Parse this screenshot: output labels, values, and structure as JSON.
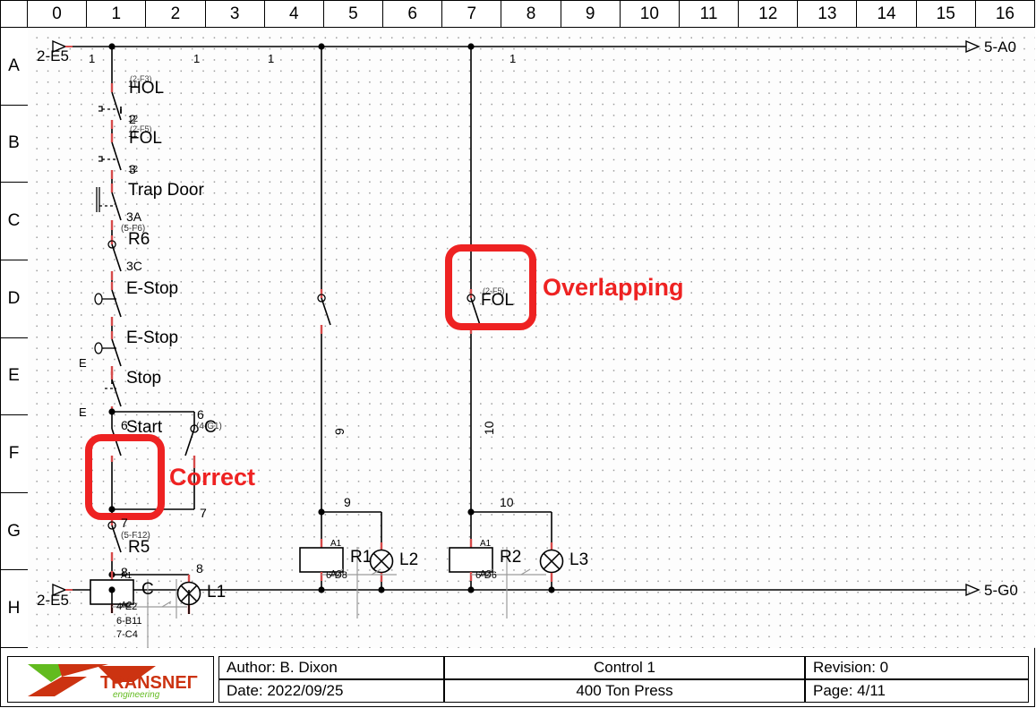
{
  "sheet": {
    "columns": [
      "0",
      "1",
      "2",
      "3",
      "4",
      "5",
      "6",
      "7",
      "8",
      "9",
      "10",
      "11",
      "12",
      "13",
      "14",
      "15",
      "16"
    ],
    "rows": [
      "A",
      "B",
      "C",
      "D",
      "E",
      "F",
      "G",
      "H"
    ]
  },
  "annotations": [
    {
      "id": "correct",
      "label": "Correct",
      "color": "#ee2222"
    },
    {
      "id": "overlapping",
      "label": "Overlapping",
      "color": "#ee2222"
    }
  ],
  "connectors": {
    "top_left": "2-E5",
    "top_right": "5-A0",
    "bottom_left": "2-E5",
    "bottom_right": "5-G0"
  },
  "wire_numbers": {
    "top_rail": [
      "1",
      "1",
      "1",
      "1"
    ],
    "rung1": [
      "2",
      "3",
      "3A",
      "3C",
      "6",
      "6",
      "7",
      "7",
      "8"
    ],
    "rung2_vertical": "9",
    "rung3_vertical": "10",
    "rung2_top": "9",
    "rung3_top": "10"
  },
  "rung1": {
    "devices": [
      {
        "name": "HOL",
        "type": "nc-limit-switch",
        "terminal_top": "11",
        "terminal_bottom": "12",
        "xref": "(2-F3)"
      },
      {
        "name": "FOL",
        "type": "nc-limit-switch",
        "terminal_top": "11",
        "terminal_bottom": "12",
        "xref": "(2-F5)"
      },
      {
        "name": "Trap Door",
        "type": "nc-door-switch",
        "wire_above": "3"
      },
      {
        "name": "R6",
        "type": "nc-relay-contact",
        "wire_above": "3A",
        "xref": "(5-F6)"
      },
      {
        "name": "E-Stop",
        "type": "nc-estop",
        "wire_above": "3C"
      },
      {
        "name": "E-Stop",
        "type": "nc-estop"
      },
      {
        "name": "Stop",
        "type": "nc-pushbutton",
        "terminal_left": "E"
      },
      {
        "name": "Start",
        "type": "no-pushbutton",
        "terminal_left": "E",
        "wire_above": "6"
      },
      {
        "name": "C",
        "type": "no-relay-contact-seal",
        "xref": "(4-G1)",
        "wire_above": "6",
        "wire_below": "7"
      },
      {
        "name": "R5",
        "type": "nc-relay-contact",
        "wire_above": "7",
        "xref": "(5-F12)"
      }
    ],
    "coil": {
      "name": "C",
      "terminal_top": "A1",
      "terminal_bottom": "A2",
      "wire_above": "8",
      "xrefs": [
        "4-E2",
        "6-B11",
        "7-C4"
      ]
    },
    "lamp": {
      "name": "L1",
      "wire": "8"
    }
  },
  "rung2": {
    "devices": [
      {
        "name": "",
        "type": "nc-relay-contact"
      }
    ],
    "coil": {
      "name": "R1",
      "terminal_top": "A1",
      "terminal_bottom": "A2",
      "xrefs": [
        "6-D8"
      ]
    },
    "lamp": {
      "name": "L2"
    }
  },
  "rung3": {
    "devices": [
      {
        "name": "FOL",
        "type": "nc-relay-contact",
        "xref": "(2-F5)"
      }
    ],
    "coil": {
      "name": "R2",
      "terminal_top": "A1",
      "terminal_bottom": "A2",
      "xrefs": [
        "6-D6"
      ]
    },
    "lamp": {
      "name": "L3"
    }
  },
  "title_block": {
    "logo_name": "TRANSNET",
    "logo_tagline": "engineering",
    "author": "Author: B. Dixon",
    "date": "Date: 2022/09/25",
    "project": "Control 1",
    "machine": "400 Ton Press",
    "revision": "Revision: 0",
    "page": "Page: 4/11"
  }
}
